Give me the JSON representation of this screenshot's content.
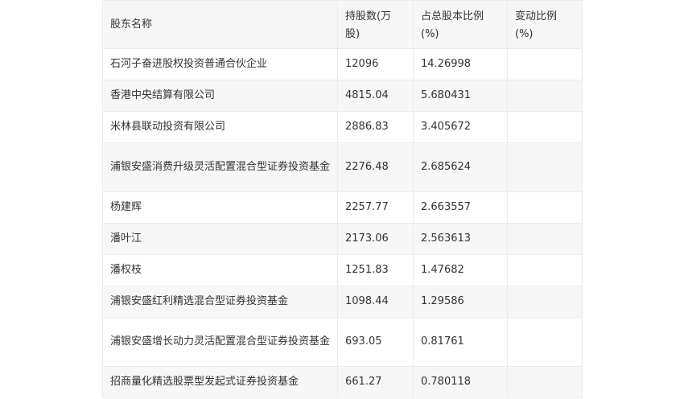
{
  "table": {
    "headers": [
      "股东名称",
      "持股数(万股)",
      "占总股本比例(%)",
      "变动比例(%)"
    ],
    "rows": [
      {
        "name": "石河子奋进股权投资普通合伙企业",
        "shares": "12096",
        "ratio": "14.26998",
        "change": ""
      },
      {
        "name": "香港中央结算有限公司",
        "shares": "4815.04",
        "ratio": "5.680431",
        "change": ""
      },
      {
        "name": "米林县联动投资有限公司",
        "shares": "2886.83",
        "ratio": "3.405672",
        "change": ""
      },
      {
        "name": "浦银安盛消费升级灵活配置混合型证券投资基金",
        "shares": "2276.48",
        "ratio": "2.685624",
        "change": ""
      },
      {
        "name": "杨建辉",
        "shares": "2257.77",
        "ratio": "2.663557",
        "change": ""
      },
      {
        "name": "潘叶江",
        "shares": "2173.06",
        "ratio": "2.563613",
        "change": ""
      },
      {
        "name": "潘权枝",
        "shares": "1251.83",
        "ratio": "1.47682",
        "change": ""
      },
      {
        "name": "浦银安盛红利精选混合型证券投资基金",
        "shares": "1098.44",
        "ratio": "1.29586",
        "change": ""
      },
      {
        "name": "浦银安盛增长动力灵活配置混合型证券投资基金",
        "shares": "693.05",
        "ratio": "0.81761",
        "change": ""
      },
      {
        "name": "招商量化精选股票型发起式证券投资基金",
        "shares": "661.27",
        "ratio": "0.780118",
        "change": ""
      }
    ]
  }
}
